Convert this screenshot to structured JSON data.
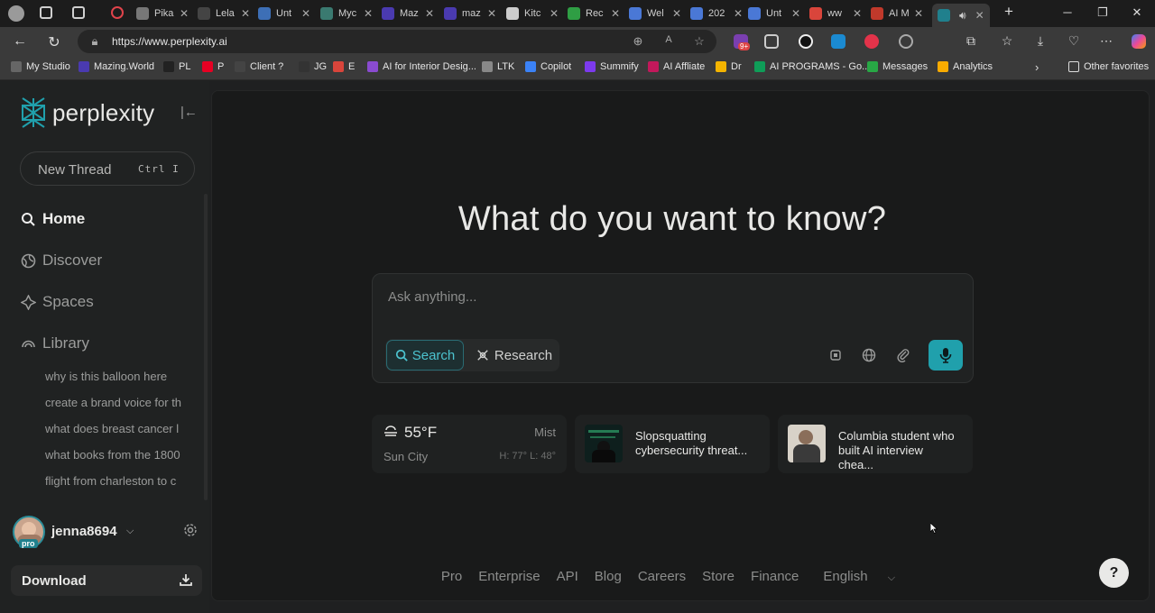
{
  "browser": {
    "tabs": [
      {
        "label": "Pika",
        "icon": "cloud-icon",
        "color": "#777777"
      },
      {
        "label": "Lela",
        "icon": "pitch-icon",
        "color": "#444444"
      },
      {
        "label": "Unt",
        "icon": "globe-icon",
        "color": "#3d6fb6"
      },
      {
        "label": "Myc",
        "icon": "chart-icon",
        "color": "#3a7a70"
      },
      {
        "label": "Maz",
        "icon": "mazing-icon",
        "color": "#4a3ab0"
      },
      {
        "label": "maz",
        "icon": "mazing-icon",
        "color": "#4a3ab0"
      },
      {
        "label": "Kitc",
        "icon": "circle-icon",
        "color": "#cccccc"
      },
      {
        "label": "Rec",
        "icon": "drive-icon",
        "color": "#2f9e44"
      },
      {
        "label": "Wel",
        "icon": "docs-icon",
        "color": "#4a78d6"
      },
      {
        "label": "202",
        "icon": "docs-icon",
        "color": "#4a78d6"
      },
      {
        "label": "Unt",
        "icon": "docs-icon",
        "color": "#4a78d6"
      },
      {
        "label": "ww",
        "icon": "gmail-icon",
        "color": "#d9453b"
      },
      {
        "label": "AI M",
        "icon": "books-icon",
        "color": "#c0392b"
      },
      {
        "label": "",
        "icon": "perplexity-icon",
        "color": "#20808d"
      }
    ],
    "url": "https://www.perplexity.ai",
    "bookmarks": [
      {
        "label": "My Studio",
        "color": "#666666"
      },
      {
        "label": "Mazing.World",
        "color": "#4a3ab0"
      },
      {
        "label": "PL",
        "color": "#222222"
      },
      {
        "label": "P",
        "color": "#e60023"
      },
      {
        "label": "Client ?",
        "color": "#444444"
      },
      {
        "label": "JG",
        "color": "#333333"
      },
      {
        "label": "E",
        "color": "#d9453b"
      },
      {
        "label": "AI for Interior Desig...",
        "color": "#8a4bd0"
      },
      {
        "label": "LTK",
        "color": "#888888"
      },
      {
        "label": "Copilot",
        "color": "#3b82f6"
      },
      {
        "label": "Summify",
        "color": "#7c3aed"
      },
      {
        "label": "AI Affliate",
        "color": "#c2185b"
      },
      {
        "label": "Dr",
        "color": "#f4b400"
      },
      {
        "label": "AI PROGRAMS - Go...",
        "color": "#0f9d58"
      },
      {
        "label": "Messages",
        "color": "#28a745"
      },
      {
        "label": "Analytics",
        "color": "#f9ab00"
      }
    ],
    "other_favorites": "Other favorites",
    "extension_badge": "9+"
  },
  "sidebar": {
    "logo_text": "perplexity",
    "new_thread": {
      "label": "New Thread",
      "shortcut": "Ctrl I"
    },
    "nav": [
      {
        "label": "Home",
        "icon": "search-icon",
        "active": true
      },
      {
        "label": "Discover",
        "icon": "globe-icon",
        "active": false
      },
      {
        "label": "Spaces",
        "icon": "spaces-icon",
        "active": false
      },
      {
        "label": "Library",
        "icon": "library-icon",
        "active": false
      }
    ],
    "library_items": [
      "why is this balloon here",
      "create a brand voice for th",
      "what does breast cancer l",
      "what books from the 1800",
      "flight from charleston to c"
    ],
    "user": {
      "name": "jenna8694",
      "badge": "pro"
    },
    "download_label": "Download"
  },
  "main": {
    "headline": "What do you want to know?",
    "ask_placeholder": "Ask anything...",
    "modes": {
      "search": "Search",
      "research": "Research"
    },
    "weather": {
      "temp": "55°F",
      "condition": "Mist",
      "city": "Sun City",
      "high_low": "H: 77° L: 48°"
    },
    "news": [
      {
        "title": "Slopsquatting cybersecurity threat..."
      },
      {
        "title": "Columbia student who built AI interview chea..."
      }
    ],
    "footer_links": [
      "Pro",
      "Enterprise",
      "API",
      "Blog",
      "Careers",
      "Store",
      "Finance",
      "English"
    ],
    "help": "?"
  },
  "colors": {
    "accent": "#20a0ac",
    "background": "#191a1a",
    "sidebar": "#202222"
  }
}
